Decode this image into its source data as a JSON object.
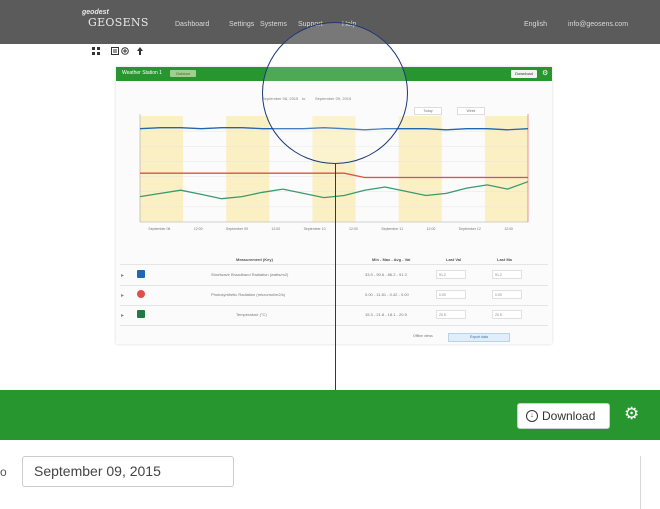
{
  "nav": {
    "logo_small": "geodest",
    "logo_main": "GEOSENS",
    "links": [
      "Dashboard",
      "Settings",
      "Systems",
      "Support",
      "Help"
    ],
    "language": "English",
    "account": "info@geosens.com"
  },
  "toolbar": {
    "icons": [
      "grid-icon",
      "list-icon",
      "plus-icon",
      "upload-icon"
    ]
  },
  "panel": {
    "title": "Weather Station 1",
    "badge": "Outdoor",
    "download_label": "Download",
    "date_from": "September 08, 2015",
    "date_to_prefix": "to",
    "date_to": "September 09, 2015",
    "range_buttons": [
      "Today",
      "Week"
    ]
  },
  "chart_data": {
    "type": "line",
    "x_ticks": [
      "September 08",
      "12:00",
      "September 09",
      "12:00",
      "September 10",
      "12:00",
      "September 11",
      "12:00",
      "September 12",
      "12:00"
    ],
    "series": [
      {
        "name": "Shortwave Broadband Radiation (watts/m2)",
        "color": "#1f67b0",
        "values": [
          0.88,
          0.89,
          0.89,
          0.88,
          0.89,
          0.89,
          0.88,
          0.88,
          0.88,
          0.89,
          0.88,
          0.87,
          0.88,
          0.88,
          0.88,
          0.87,
          0.88,
          0.88,
          0.87,
          0.88
        ]
      },
      {
        "name": "Photosynthetic Radiation (micromol/m2/s)",
        "color": "#e04f4a",
        "values": [
          0.46,
          0.46,
          0.46,
          0.46,
          0.46,
          0.46,
          0.46,
          0.46,
          0.46,
          0.46,
          0.46,
          0.42,
          0.42,
          0.42,
          0.42,
          0.42,
          0.42,
          0.42,
          0.42,
          0.42
        ]
      },
      {
        "name": "Temperature (°C)",
        "color": "#3a9a6e",
        "values": [
          0.24,
          0.27,
          0.3,
          0.26,
          0.22,
          0.24,
          0.28,
          0.31,
          0.27,
          0.23,
          0.25,
          0.3,
          0.33,
          0.29,
          0.25,
          0.27,
          0.32,
          0.35,
          0.31,
          0.38
        ]
      }
    ],
    "bands": [
      "day",
      "night",
      "day",
      "night",
      "day",
      "night",
      "day",
      "night",
      "day"
    ]
  },
  "table": {
    "headers": [
      "Measurement (Key)",
      "Min - Max - Avg - Val",
      "Last Val",
      "Last Ma"
    ],
    "rows": [
      {
        "color": "#1f67b0",
        "label": "Shortwave Broadband Radiation (watts/m2)",
        "stats": "33.9 - 90.6 - 86.2 - 91.2",
        "last": "91.2",
        "last_max": "91.2"
      },
      {
        "color": "#e04f4a",
        "label": "Photosynthetic Radiation (micromol/m2/s)",
        "stats": "0.00 - 11.81 - 0.42 - 0.00",
        "last": "0.00",
        "last_max": "0.00"
      },
      {
        "color": "#217a46",
        "label": "Temperature (°C)",
        "stats": "15.3 - 21.8 - 18.1 - 20.5",
        "last": "20.5",
        "last_max": "20.5"
      }
    ],
    "export_label": "Export data",
    "export_prefix": "Offline views"
  },
  "zoom": {
    "download_label": "Download",
    "date_prefix": "o",
    "date_value": "September 09, 2015"
  }
}
